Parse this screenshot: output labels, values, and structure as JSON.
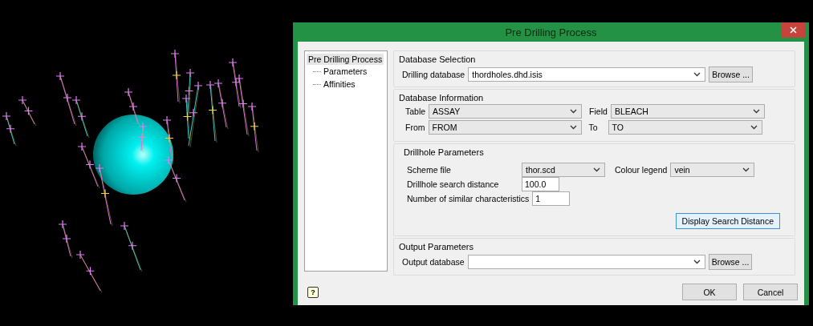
{
  "dialog": {
    "title": "Pre Drilling Process"
  },
  "tree": {
    "label": "Pre Drilling Process",
    "selected": true,
    "expanded": true,
    "children": [
      {
        "label": "Parameters",
        "selected": false
      },
      {
        "label": "Affinities",
        "selected": false
      }
    ]
  },
  "groups": [
    {
      "kind": "selection",
      "title": "Database Selection",
      "label": "Drilling database",
      "value": "thordholes.dhd.isis",
      "button": "Browse ..."
    },
    {
      "kind": "information",
      "title": "Database Information",
      "fields": [
        {
          "label": "Table",
          "value": "ASSAY"
        },
        {
          "label": "Field",
          "value": "BLEACH"
        },
        {
          "label": "From",
          "value": "FROM"
        },
        {
          "label": "To",
          "value": "TO"
        }
      ]
    },
    {
      "kind": "drillhole",
      "title": "Drillhole Parameters",
      "scheme": {
        "label": "Scheme file",
        "value": "thor.scd"
      },
      "legend": {
        "label": "Colour legend",
        "value": "vein"
      },
      "distance": {
        "label": "Drillhole search distance",
        "value": "100.0"
      },
      "similar": {
        "label": "Number of similar characteristics",
        "value": "1"
      },
      "button": "Display Search Distance"
    },
    {
      "kind": "output",
      "title": "Output Parameters",
      "label": "Output database",
      "button": "Browse ..."
    }
  ],
  "footer": {
    "help": "?",
    "buttons": [
      "OK",
      "Cancel"
    ]
  }
}
